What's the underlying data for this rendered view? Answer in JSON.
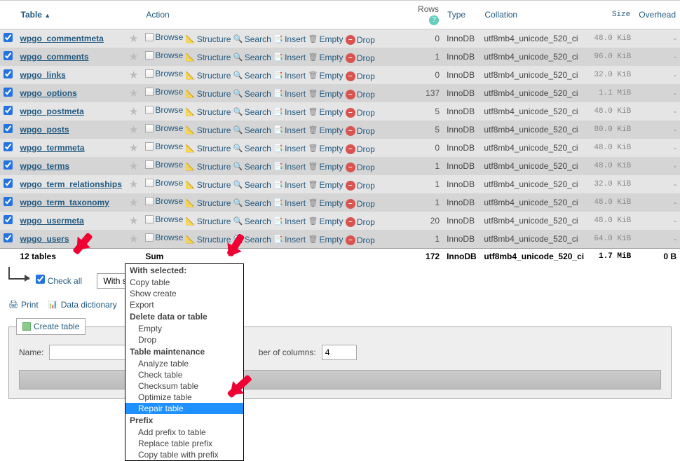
{
  "headers": {
    "table": "Table",
    "action": "Action",
    "rows": "Rows",
    "type": "Type",
    "collation": "Collation",
    "size": "Size",
    "overhead": "Overhead"
  },
  "actions": {
    "browse": "Browse",
    "structure": "Structure",
    "search": "Search",
    "insert": "Insert",
    "empty": "Empty",
    "drop": "Drop"
  },
  "tables": [
    {
      "name": "wpgo_commentmeta",
      "rows": 0,
      "type": "InnoDB",
      "collation": "utf8mb4_unicode_520_ci",
      "size": "48.0 KiB",
      "overhead": "-"
    },
    {
      "name": "wpgo_comments",
      "rows": 1,
      "type": "InnoDB",
      "collation": "utf8mb4_unicode_520_ci",
      "size": "96.0 KiB",
      "overhead": "-"
    },
    {
      "name": "wpgo_links",
      "rows": 0,
      "type": "InnoDB",
      "collation": "utf8mb4_unicode_520_ci",
      "size": "32.0 KiB",
      "overhead": "-"
    },
    {
      "name": "wpgo_options",
      "rows": 137,
      "type": "InnoDB",
      "collation": "utf8mb4_unicode_520_ci",
      "size": "1.1 MiB",
      "overhead": "-"
    },
    {
      "name": "wpgo_postmeta",
      "rows": 5,
      "type": "InnoDB",
      "collation": "utf8mb4_unicode_520_ci",
      "size": "48.0 KiB",
      "overhead": "-"
    },
    {
      "name": "wpgo_posts",
      "rows": 5,
      "type": "InnoDB",
      "collation": "utf8mb4_unicode_520_ci",
      "size": "80.0 KiB",
      "overhead": "-"
    },
    {
      "name": "wpgo_termmeta",
      "rows": 0,
      "type": "InnoDB",
      "collation": "utf8mb4_unicode_520_ci",
      "size": "48.0 KiB",
      "overhead": "-"
    },
    {
      "name": "wpgo_terms",
      "rows": 1,
      "type": "InnoDB",
      "collation": "utf8mb4_unicode_520_ci",
      "size": "48.0 KiB",
      "overhead": "-"
    },
    {
      "name": "wpgo_term_relationships",
      "rows": 1,
      "type": "InnoDB",
      "collation": "utf8mb4_unicode_520_ci",
      "size": "32.0 KiB",
      "overhead": "-"
    },
    {
      "name": "wpgo_term_taxonomy",
      "rows": 1,
      "type": "InnoDB",
      "collation": "utf8mb4_unicode_520_ci",
      "size": "48.0 KiB",
      "overhead": "-"
    },
    {
      "name": "wpgo_usermeta",
      "rows": 20,
      "type": "InnoDB",
      "collation": "utf8mb4_unicode_520_ci",
      "size": "48.0 KiB",
      "overhead": "-"
    },
    {
      "name": "wpgo_users",
      "rows": 1,
      "type": "InnoDB",
      "collation": "utf8mb4_unicode_520_ci",
      "size": "64.0 KiB",
      "overhead": "-"
    }
  ],
  "summary": {
    "count_label": "12 tables",
    "sum_label": "Sum",
    "rows": 172,
    "type": "InnoDB",
    "collation": "utf8mb4_unicode_520_ci",
    "size": "1.7 MiB",
    "overhead": "0 B"
  },
  "checkall": {
    "label": "Check all",
    "with_selected": "With selected:"
  },
  "dropdown": {
    "h1": "With selected:",
    "copy": "Copy table",
    "show_create": "Show create",
    "export": "Export",
    "h2": "Delete data or table",
    "empty": "Empty",
    "drop": "Drop",
    "h3": "Table maintenance",
    "analyze": "Analyze table",
    "check": "Check table",
    "checksum": "Checksum table",
    "optimize": "Optimize table",
    "repair": "Repair table",
    "h4": "Prefix",
    "add_prefix": "Add prefix to table",
    "replace_prefix": "Replace table prefix",
    "copy_prefix": "Copy table with prefix"
  },
  "tools": {
    "print": "Print",
    "dict": "Data dictionary"
  },
  "create": {
    "legend": "Create table",
    "name_label": "Name:",
    "cols_label": "Number of columns:",
    "cols_value": "4"
  }
}
